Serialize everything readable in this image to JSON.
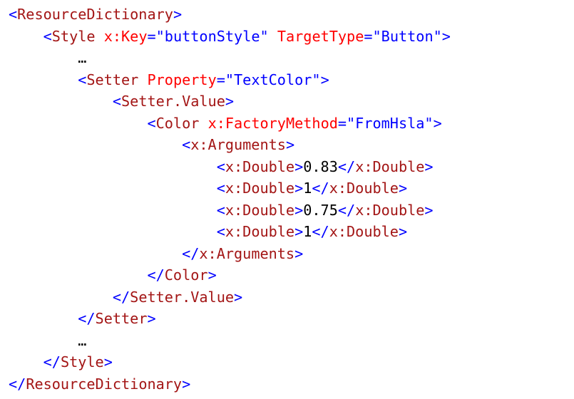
{
  "code": {
    "indent_unit": "    ",
    "lines": [
      {
        "indent": 0,
        "tokens": [
          {
            "t": "punct",
            "v": "<"
          },
          {
            "t": "tag",
            "v": "ResourceDictionary"
          },
          {
            "t": "punct",
            "v": ">"
          }
        ]
      },
      {
        "indent": 1,
        "tokens": [
          {
            "t": "punct",
            "v": "<"
          },
          {
            "t": "tag",
            "v": "Style"
          },
          {
            "t": "text",
            "v": " "
          },
          {
            "t": "attr",
            "v": "x:Key"
          },
          {
            "t": "punct",
            "v": "="
          },
          {
            "t": "value",
            "v": "\"buttonStyle\""
          },
          {
            "t": "text",
            "v": " "
          },
          {
            "t": "attr",
            "v": "TargetType"
          },
          {
            "t": "punct",
            "v": "="
          },
          {
            "t": "value",
            "v": "\"Button\""
          },
          {
            "t": "punct",
            "v": ">"
          }
        ]
      },
      {
        "indent": 2,
        "tokens": [
          {
            "t": "ellipsis",
            "v": "…"
          }
        ]
      },
      {
        "indent": 2,
        "tokens": [
          {
            "t": "punct",
            "v": "<"
          },
          {
            "t": "tag",
            "v": "Setter"
          },
          {
            "t": "text",
            "v": " "
          },
          {
            "t": "attr",
            "v": "Property"
          },
          {
            "t": "punct",
            "v": "="
          },
          {
            "t": "value",
            "v": "\"TextColor\""
          },
          {
            "t": "punct",
            "v": ">"
          }
        ]
      },
      {
        "indent": 3,
        "tokens": [
          {
            "t": "punct",
            "v": "<"
          },
          {
            "t": "tag",
            "v": "Setter.Value"
          },
          {
            "t": "punct",
            "v": ">"
          }
        ]
      },
      {
        "indent": 4,
        "tokens": [
          {
            "t": "punct",
            "v": "<"
          },
          {
            "t": "tag",
            "v": "Color"
          },
          {
            "t": "text",
            "v": " "
          },
          {
            "t": "attr",
            "v": "x:FactoryMethod"
          },
          {
            "t": "punct",
            "v": "="
          },
          {
            "t": "value",
            "v": "\"FromHsla\""
          },
          {
            "t": "punct",
            "v": ">"
          }
        ]
      },
      {
        "indent": 5,
        "tokens": [
          {
            "t": "punct",
            "v": "<"
          },
          {
            "t": "tag",
            "v": "x:Arguments"
          },
          {
            "t": "punct",
            "v": ">"
          }
        ]
      },
      {
        "indent": 6,
        "tokens": [
          {
            "t": "punct",
            "v": "<"
          },
          {
            "t": "tag",
            "v": "x:Double"
          },
          {
            "t": "punct",
            "v": ">"
          },
          {
            "t": "text",
            "v": "0.83"
          },
          {
            "t": "punct",
            "v": "</"
          },
          {
            "t": "tag",
            "v": "x:Double"
          },
          {
            "t": "punct",
            "v": ">"
          }
        ]
      },
      {
        "indent": 6,
        "tokens": [
          {
            "t": "punct",
            "v": "<"
          },
          {
            "t": "tag",
            "v": "x:Double"
          },
          {
            "t": "punct",
            "v": ">"
          },
          {
            "t": "text",
            "v": "1"
          },
          {
            "t": "punct",
            "v": "</"
          },
          {
            "t": "tag",
            "v": "x:Double"
          },
          {
            "t": "punct",
            "v": ">"
          }
        ]
      },
      {
        "indent": 6,
        "tokens": [
          {
            "t": "punct",
            "v": "<"
          },
          {
            "t": "tag",
            "v": "x:Double"
          },
          {
            "t": "punct",
            "v": ">"
          },
          {
            "t": "text",
            "v": "0.75"
          },
          {
            "t": "punct",
            "v": "</"
          },
          {
            "t": "tag",
            "v": "x:Double"
          },
          {
            "t": "punct",
            "v": ">"
          }
        ]
      },
      {
        "indent": 6,
        "tokens": [
          {
            "t": "punct",
            "v": "<"
          },
          {
            "t": "tag",
            "v": "x:Double"
          },
          {
            "t": "punct",
            "v": ">"
          },
          {
            "t": "text",
            "v": "1"
          },
          {
            "t": "punct",
            "v": "</"
          },
          {
            "t": "tag",
            "v": "x:Double"
          },
          {
            "t": "punct",
            "v": ">"
          }
        ]
      },
      {
        "indent": 5,
        "tokens": [
          {
            "t": "punct",
            "v": "</"
          },
          {
            "t": "tag",
            "v": "x:Arguments"
          },
          {
            "t": "punct",
            "v": ">"
          }
        ]
      },
      {
        "indent": 4,
        "tokens": [
          {
            "t": "punct",
            "v": "</"
          },
          {
            "t": "tag",
            "v": "Color"
          },
          {
            "t": "punct",
            "v": ">"
          }
        ]
      },
      {
        "indent": 3,
        "tokens": [
          {
            "t": "punct",
            "v": "</"
          },
          {
            "t": "tag",
            "v": "Setter.Value"
          },
          {
            "t": "punct",
            "v": ">"
          }
        ]
      },
      {
        "indent": 2,
        "tokens": [
          {
            "t": "punct",
            "v": "</"
          },
          {
            "t": "tag",
            "v": "Setter"
          },
          {
            "t": "punct",
            "v": ">"
          }
        ]
      },
      {
        "indent": 2,
        "tokens": [
          {
            "t": "ellipsis",
            "v": "…"
          }
        ]
      },
      {
        "indent": 1,
        "tokens": [
          {
            "t": "punct",
            "v": "</"
          },
          {
            "t": "tag",
            "v": "Style"
          },
          {
            "t": "punct",
            "v": ">"
          }
        ]
      },
      {
        "indent": 0,
        "tokens": [
          {
            "t": "punct",
            "v": "</"
          },
          {
            "t": "tag",
            "v": "ResourceDictionary"
          },
          {
            "t": "punct",
            "v": ">"
          }
        ]
      }
    ]
  },
  "colors": {
    "punct": "#0000ff",
    "tag": "#a31515",
    "attr": "#ff0000",
    "value": "#0000ff",
    "text": "#000000",
    "background": "#ffffff"
  }
}
